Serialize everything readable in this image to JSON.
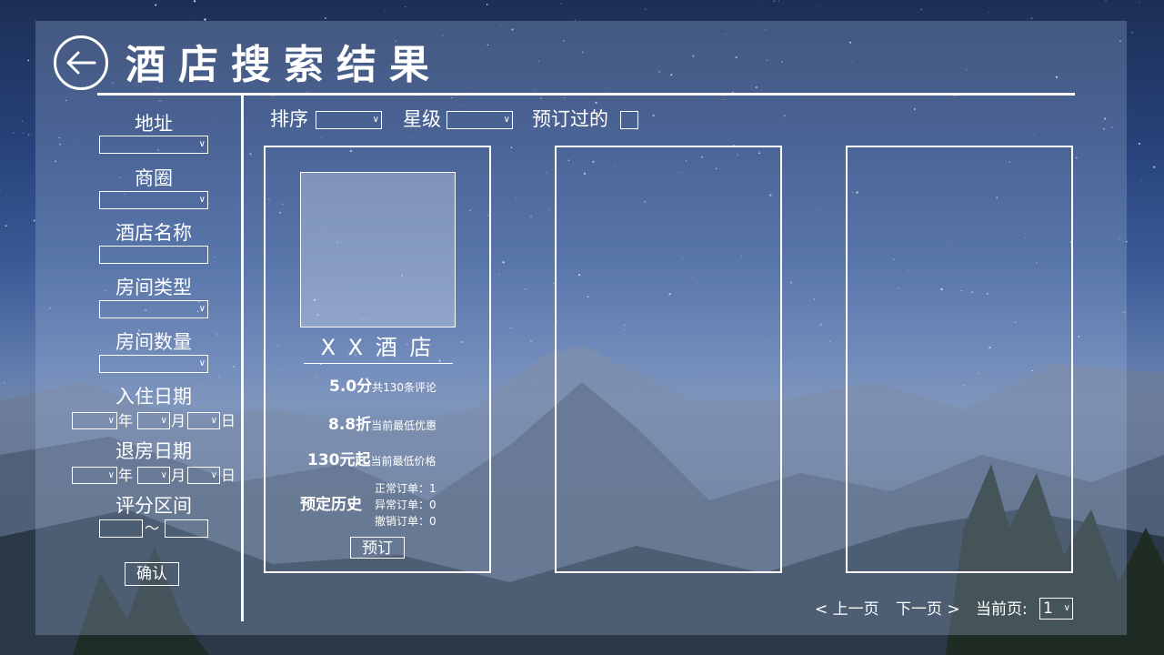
{
  "header": {
    "title": "酒店搜索结果"
  },
  "sidebar": {
    "address_label": "地址",
    "business_area_label": "商圈",
    "hotel_name_label": "酒店名称",
    "room_type_label": "房间类型",
    "room_count_label": "房间数量",
    "checkin_label": "入住日期",
    "checkout_label": "退房日期",
    "score_range_label": "评分区间",
    "year_unit": "年",
    "month_unit": "月",
    "day_unit": "日",
    "range_sep": "～",
    "confirm_label": "确认"
  },
  "filters": {
    "sort_label": "排序",
    "star_label": "星级",
    "booked_label": "预订过的"
  },
  "cards": [
    {
      "name": "X X 酒 店",
      "score": "5.0分",
      "reviews": "共130条评论",
      "discount": "8.8折",
      "discount_note": "当前最低优惠",
      "price": "130元起",
      "price_note": "当前最低价格",
      "history_label": "预定历史",
      "history_normal": "正常订单：1",
      "history_abnormal": "异常订单：0",
      "history_cancel": "撤销订单：0",
      "book_label": "预订"
    }
  ],
  "pagination": {
    "prev_label": "< 上一页",
    "next_label": "下一页 >",
    "current_label": "当前页:",
    "current_page": "1"
  }
}
